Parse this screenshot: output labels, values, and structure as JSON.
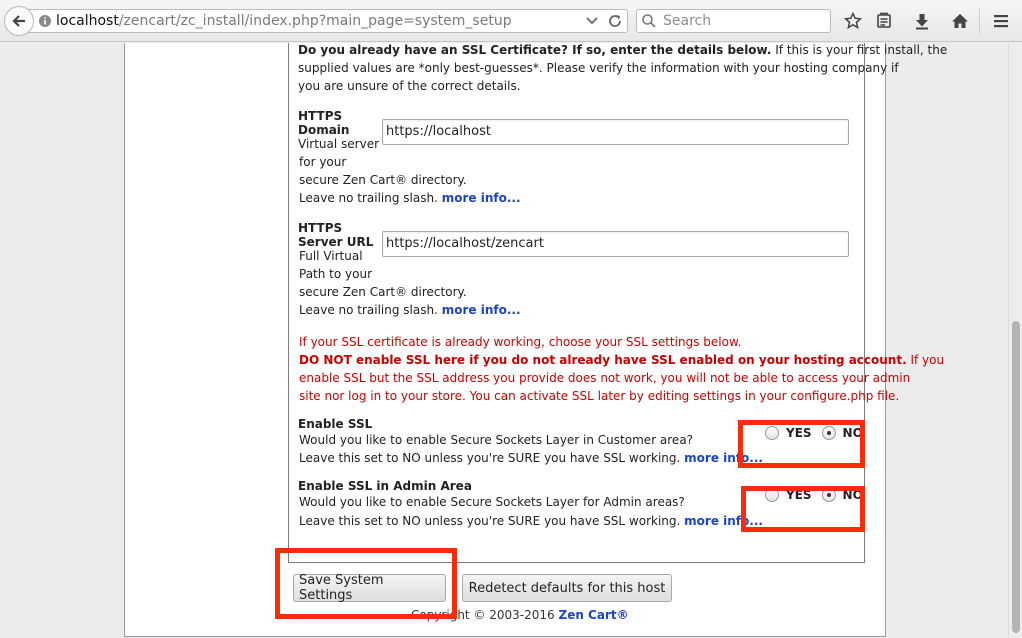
{
  "browser": {
    "url_host": "localhost",
    "url_path": "/zencart/zc_install/index.php?main_page=system_setup",
    "search_placeholder": "Search"
  },
  "ssl": {
    "intro_bold": "Do you already have an SSL Certificate? If so, enter the details below.",
    "intro_line1_rest": " If this is your first install, the",
    "intro_line2": "supplied values are *only best-guesses*. Please verify the information with your hosting company if",
    "intro_line3": "you are unsure of the correct details.",
    "https_domain": {
      "label1": "HTTPS",
      "label2": "Domain",
      "desc1": "Virtual server",
      "desc2": "for your",
      "desc3": "secure Zen Cart® directory.",
      "desc4": "Leave no trailing slash. ",
      "more": "more info...",
      "value": "https://localhost"
    },
    "https_server": {
      "label1": "HTTPS",
      "label2": "Server URL",
      "desc1": "Full Virtual",
      "desc2": "Path to your",
      "desc3": "secure Zen Cart® directory.",
      "desc4": "Leave no trailing slash. ",
      "more": "more info...",
      "value": "https://localhost/zencart"
    },
    "warning": {
      "line1": "If your SSL certificate is already working, choose your SSL settings below.",
      "line2_bold": "DO NOT enable SSL here if you do not already have SSL enabled on your hosting account.",
      "line2_rest": " If you",
      "line3": "enable SSL but the SSL address you provide does not work, you will not be able to access your admin",
      "line4": "site nor log in to your store. You can activate SSL later by editing settings in your configure.php file."
    },
    "enable_ssl": {
      "title": "Enable SSL",
      "desc1": "Would you like to enable Secure Sockets Layer in Customer area?",
      "desc2": "Leave this set to NO unless you're SURE you have SSL working. ",
      "more": "more info...",
      "yes": "YES",
      "no": "NO",
      "selected": "NO"
    },
    "enable_ssl_admin": {
      "title": "Enable SSL in Admin Area",
      "desc1": "Would you like to enable Secure Sockets Layer for Admin areas?",
      "desc2": "Leave this set to NO unless you're SURE you have SSL working. ",
      "more": "more info...",
      "yes": "YES",
      "no": "NO",
      "selected": "NO"
    }
  },
  "buttons": {
    "save": "Save System Settings",
    "redetect": "Redetect defaults for this host"
  },
  "footer": {
    "copyright": "Copyright © 2003-2016 ",
    "brand": "Zen Cart®"
  },
  "colors": {
    "highlight": "#ff2a0a",
    "link": "#1b44c8",
    "warning": "#cc0000"
  }
}
